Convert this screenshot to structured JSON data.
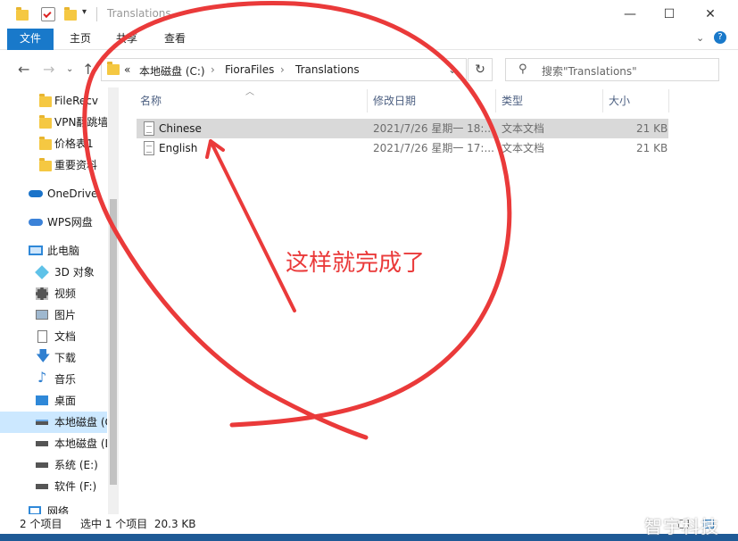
{
  "window": {
    "title": "Translations"
  },
  "ribbon": {
    "tabs": [
      "文件",
      "主页",
      "共享",
      "查看"
    ]
  },
  "address": {
    "overflow": "«",
    "crumbs": [
      "本地磁盘 (C:)",
      "FioraFiles",
      "Translations"
    ],
    "search_placeholder": "搜索\"Translations\""
  },
  "sidebar": {
    "items": [
      {
        "label": "FileRecv",
        "icon": "folder-icon"
      },
      {
        "label": "VPN翻跳墙",
        "icon": "folder-icon"
      },
      {
        "label": "价格表1",
        "icon": "folder-icon"
      },
      {
        "label": "重要资料",
        "icon": "folder-icon"
      },
      {
        "label": "OneDrive",
        "icon": "cloud-icon"
      },
      {
        "label": "WPS网盘",
        "icon": "cloud-icon"
      },
      {
        "label": "此电脑",
        "icon": "computer-icon"
      },
      {
        "label": "3D 对象",
        "icon": "cube-icon"
      },
      {
        "label": "视频",
        "icon": "video-icon"
      },
      {
        "label": "图片",
        "icon": "picture-icon"
      },
      {
        "label": "文档",
        "icon": "document-icon"
      },
      {
        "label": "下载",
        "icon": "download-icon"
      },
      {
        "label": "音乐",
        "icon": "music-icon"
      },
      {
        "label": "桌面",
        "icon": "desktop-icon"
      },
      {
        "label": "本地磁盘 (C:)",
        "icon": "drive-icon"
      },
      {
        "label": "本地磁盘 (D:)",
        "icon": "drive-icon"
      },
      {
        "label": "系统 (E:)",
        "icon": "drive-icon"
      },
      {
        "label": "软件 (F:)",
        "icon": "drive-icon"
      },
      {
        "label": "网络",
        "icon": "network-icon"
      }
    ]
  },
  "columns": {
    "name": "名称",
    "modified": "修改日期",
    "type": "类型",
    "size": "大小"
  },
  "files": [
    {
      "name": "Chinese",
      "modified": "2021/7/26 星期一 18:...",
      "type": "文本文档",
      "size": "21 KB"
    },
    {
      "name": "English",
      "modified": "2021/7/26 星期一 17:...",
      "type": "文本文档",
      "size": "21 KB"
    }
  ],
  "status": {
    "count": "2 个项目",
    "selected": "选中 1 个项目  20.3 KB"
  },
  "annotation": {
    "text": "这样就完成了",
    "color": "#ea3a3a"
  },
  "watermark": "智宇科技",
  "colors": {
    "file_tab": "#1979ca",
    "selection": "#cce8ff",
    "row_selected": "#d9d9d9"
  }
}
